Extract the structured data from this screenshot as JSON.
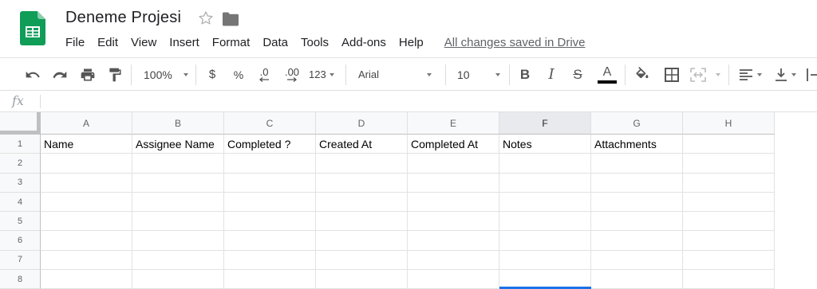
{
  "app": {
    "doc_title": "Deneme Projesi",
    "brand_color": "#0f9d58",
    "accent_color": "#1a73e8",
    "icons": {
      "star": "star-outline-icon",
      "folder": "folder-icon"
    }
  },
  "menu": {
    "items": [
      "File",
      "Edit",
      "View",
      "Insert",
      "Format",
      "Data",
      "Tools",
      "Add-ons",
      "Help"
    ],
    "save_status": "All changes saved in Drive"
  },
  "toolbar": {
    "zoom": "100%",
    "currency": "$",
    "percent": "%",
    "decrease_decimal": ".0",
    "increase_decimal": ".00",
    "more_formats": "123",
    "font_name": "Arial",
    "font_size": "10",
    "bold": "B",
    "italic": "I",
    "strikethrough": "S",
    "text_color_letter": "A"
  },
  "formula_bar": {
    "label": "fx",
    "value": ""
  },
  "grid": {
    "columns": [
      "A",
      "B",
      "C",
      "D",
      "E",
      "F",
      "G",
      "H"
    ],
    "selected_column": "F",
    "row_numbers": [
      "1",
      "2",
      "3",
      "4",
      "5",
      "6",
      "7",
      "8"
    ],
    "cells": [
      [
        "Name",
        "Assignee Name",
        "Completed ?",
        "Created At",
        "Completed At",
        "Notes",
        "Attachments",
        ""
      ],
      [
        "",
        "",
        "",
        "",
        "",
        "",
        "",
        ""
      ],
      [
        "",
        "",
        "",
        "",
        "",
        "",
        "",
        ""
      ],
      [
        "",
        "",
        "",
        "",
        "",
        "",
        "",
        ""
      ],
      [
        "",
        "",
        "",
        "",
        "",
        "",
        "",
        ""
      ],
      [
        "",
        "",
        "",
        "",
        "",
        "",
        "",
        ""
      ],
      [
        "",
        "",
        "",
        "",
        "",
        "",
        "",
        ""
      ],
      [
        "",
        "",
        "",
        "",
        "",
        "",
        "",
        ""
      ]
    ]
  }
}
